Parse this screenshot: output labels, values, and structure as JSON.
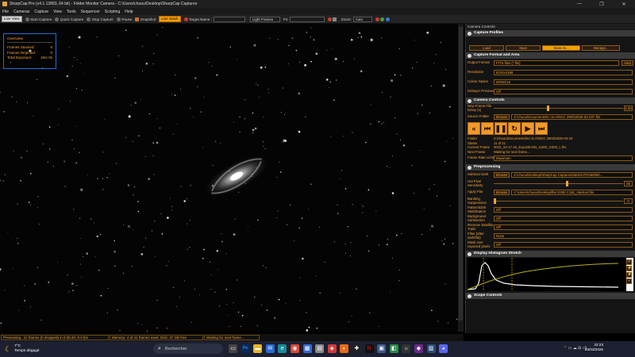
{
  "window": {
    "title": "SharpCap Pro (v4.1.12893, 64 bit) - Folder Monitor Camera - C:\\Users\\chuou\\Desktop\\SharpCap Captures",
    "controls": [
      "—",
      "❐",
      "✕"
    ]
  },
  "menu": [
    "File",
    "Cameras",
    "Capture",
    "View",
    "Tools",
    "Sequencer",
    "Scripting",
    "Help"
  ],
  "toolbar": {
    "live_view": "Live View",
    "start_capture": "Start Capture",
    "quick_capture": "Quick Capture",
    "stop_capture": "Stop Capture",
    "pause": "Pause",
    "snapshot": "Snapshot",
    "live_stack": "Live Stack",
    "target_name_label": "Target Name :",
    "target_name_value": "",
    "frame_type": "Light Frames",
    "fx_label": "FX",
    "fx_value": "",
    "zoom_label": "Zoom:",
    "zoom_value": "Auto"
  },
  "overview": {
    "title": "Overview",
    "frames_stacked_label": "Frames Stacked:",
    "frames_stacked_value": "5",
    "frames_rejected_label": "Frames Rejected:",
    "frames_rejected_value": "0",
    "total_exposure_label": "Total Exposure:",
    "total_exposure_value": "15m 0s"
  },
  "status": {
    "previewing": "Previewing : 11 frames (0 dropped) in 0:36:40, 0.0 fps",
    "memory": "Memory: 4 of 41 frames used. Disk: 37 GB free",
    "waiting": "Waiting for next frame..."
  },
  "panel": {
    "title": "Camera Controls",
    "capture_profiles": {
      "header": "Capture Profiles",
      "buttons": [
        "Load",
        "Save",
        "Save As...",
        "Manage..."
      ]
    },
    "capture_format": {
      "header": "Capture Format and Area",
      "output_format_label": "Output Format",
      "output_format_value": "FITS files (*.fits)",
      "auto_label": "Auto",
      "resolution_label": "Resolution",
      "resolution_value": "6224x4168",
      "colour_space_label": "Colour Space",
      "colour_space_value": "MONO16",
      "debayer_label": "Debayer Preview",
      "debayer_value": "Off"
    },
    "camera_controls": {
      "header": "Camera Controls",
      "new_frame_label": "New Frame File Delay (s)",
      "new_frame_value": "5.00",
      "source_folder_label": "Source Folder",
      "browse": "Browse",
      "source_folder_value": "Z:\\chuou\\Documents\\N.I.N.A\\NGC 2903\\2026-03-23\\*.fits",
      "folder_label": "Folder",
      "folder_value": "Z:\\chuou\\Documents\\N.I.N.A\\NGC 2903\\2026-03-23",
      "status_label": "Status",
      "status_value": "11 of 11",
      "current_frame_label": "Current Frame",
      "current_frame_value": "0010_22-17-42_Exp180.00s_G300_O300_L.fits",
      "next_frame_label": "Next Frame",
      "next_frame_value": "Waiting for next frame...",
      "frame_rate_label": "Frame Rate Limit",
      "frame_rate_value": "Maximum"
    },
    "preprocessing": {
      "header": "Preprocessing",
      "subtract_dark_label": "Subtract Dark",
      "subtract_dark_value": "Z:\\chuou\\Desktop\\SharpCap Captures\\darks\\ATR2600M\\...",
      "hot_pixel_label": "Hot Pixel Sensitivity",
      "hot_pixel_value": "25",
      "apply_flat_label": "Apply Flat",
      "apply_flat_value": "C:\\Users\\chuou\\Desktop\\flat G300 C11E_stacked.fits",
      "banding_label": "Banding Suppression",
      "banding_value": "0",
      "pattern_label": "Pattern/Disk Stabilization",
      "pattern_value": "Off",
      "background_label": "Background Subtraction",
      "background_value": "Off",
      "satellite_label": "Remove Satellite Trails",
      "satellite_value": "Off",
      "filter_label": "Filter (after dark/flat)",
      "filter_value": "None",
      "mask_label": "Mask over exposed pixels",
      "mask_value": "Off"
    },
    "histogram": {
      "header": "Display Histogram Stretch"
    },
    "scope_controls": {
      "header": "Scope Controls"
    }
  },
  "taskbar": {
    "temperature": "7°C",
    "weather": "Temps dégagé",
    "search_placeholder": "Rechercher",
    "time": "22:23",
    "date": "23/03/2026"
  },
  "colors": {
    "accent": "#f7a43a",
    "overview_border": "#1e6fd9",
    "taskbar": "#1c2030"
  }
}
